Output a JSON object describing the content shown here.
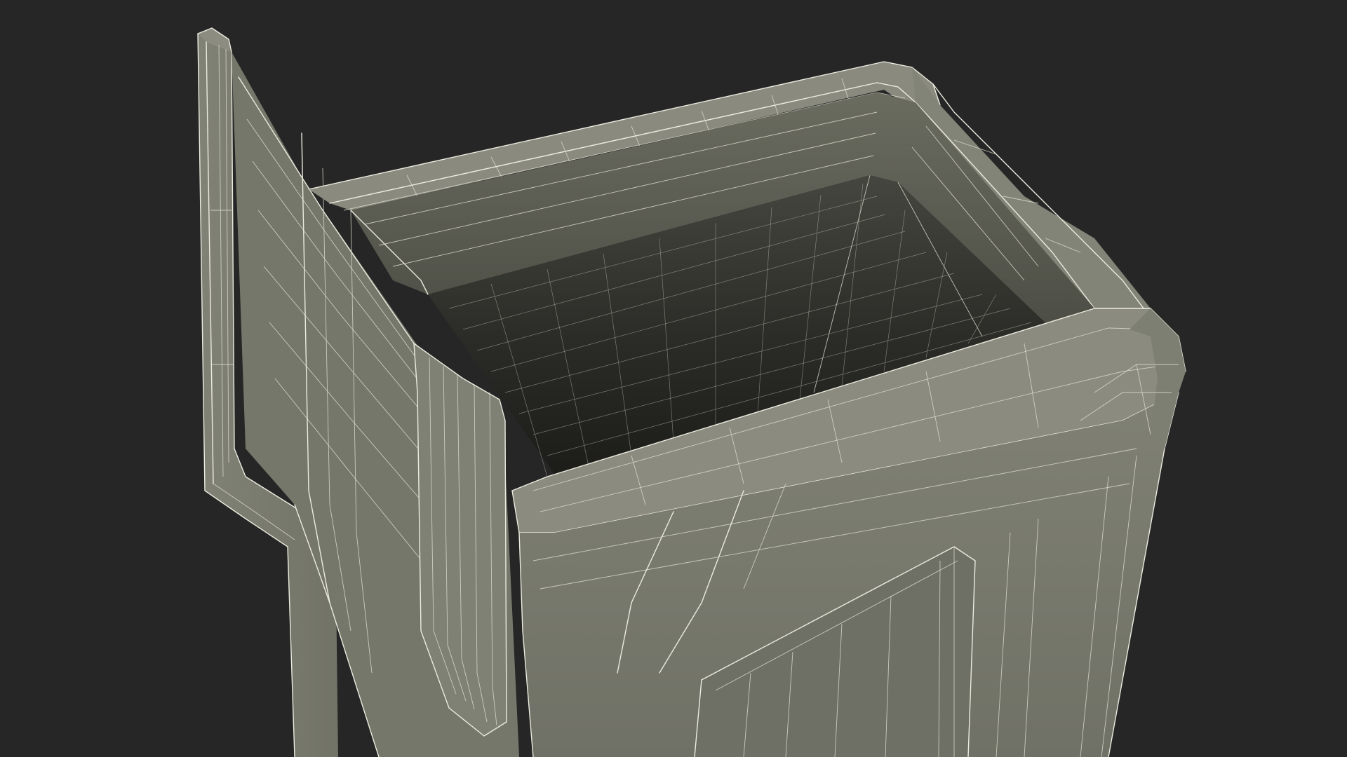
{
  "scene": {
    "subject": "wireframe-bin-model",
    "background_color": "#262626",
    "surface_color": "#7b7c6f",
    "surface_shadow_color": "#5e5f54",
    "interior_color": "#3a3b35",
    "interior_dark_color": "#1f201c",
    "wire_color": "#ecebe0"
  }
}
